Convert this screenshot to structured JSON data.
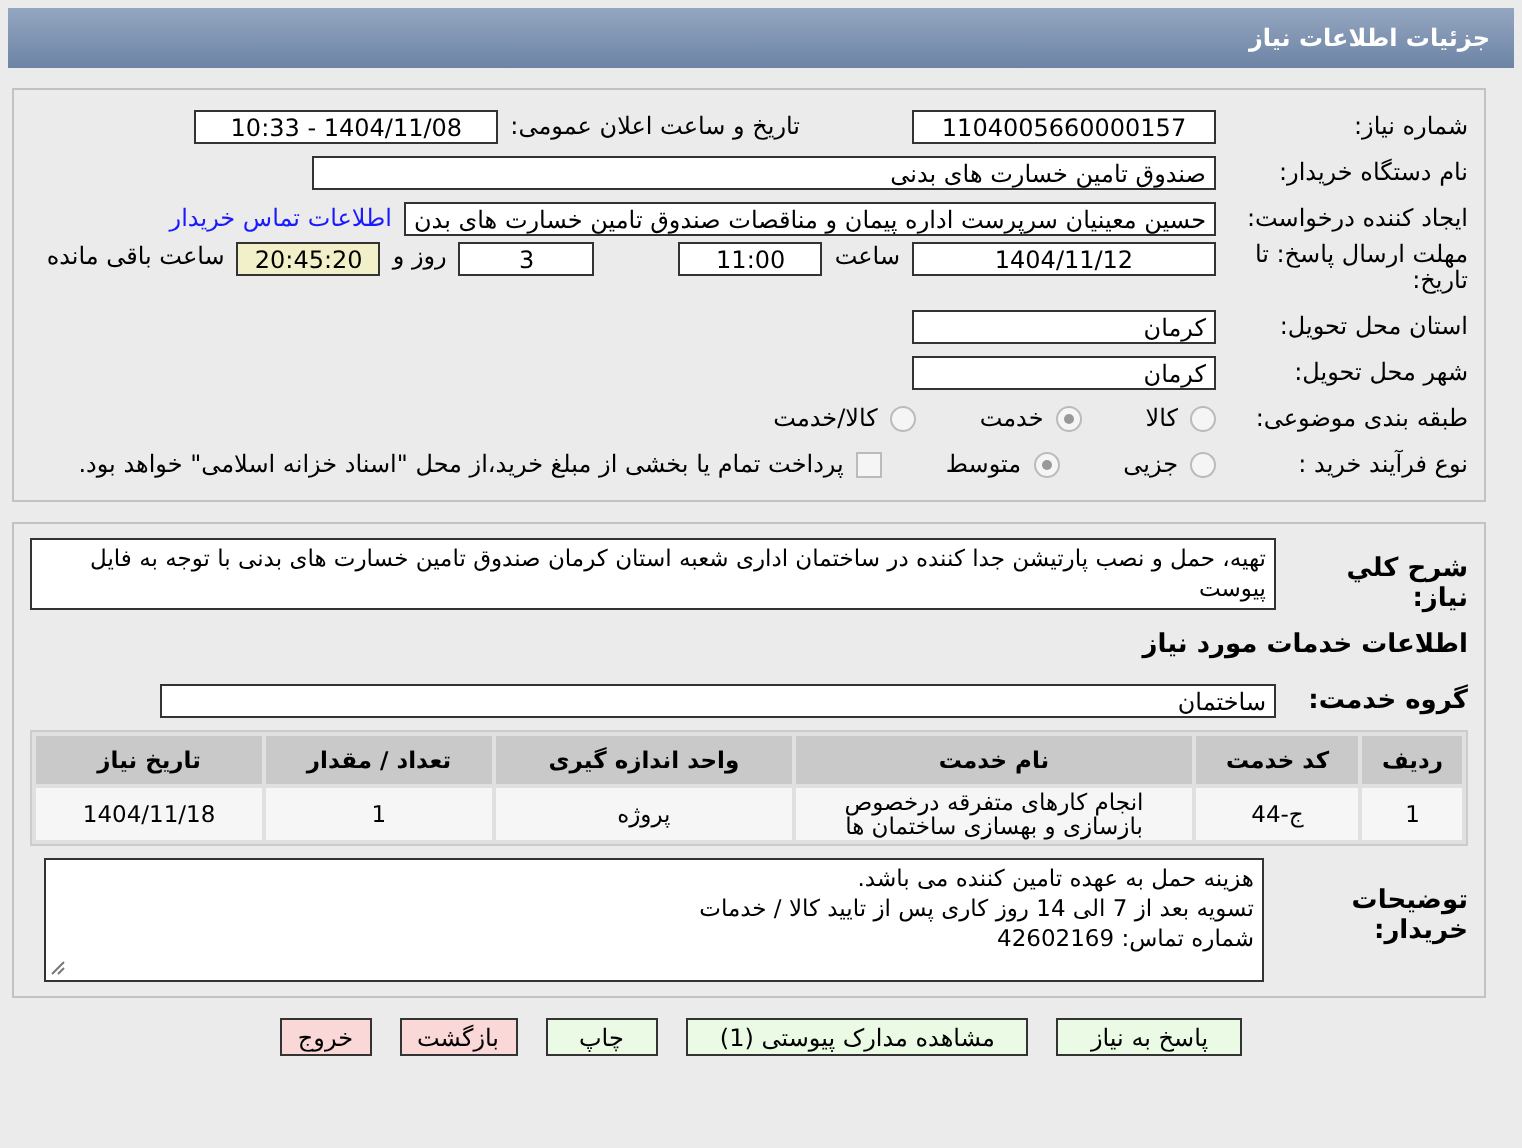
{
  "header": {
    "title": "جزئیات اطلاعات نیاز"
  },
  "need_number": {
    "label": "شماره نیاز:",
    "value": "1104005660000157"
  },
  "announce": {
    "label": "تاریخ و ساعت اعلان عمومی:",
    "value": "1404/11/08 - 10:33"
  },
  "buyer": {
    "label": "نام دستگاه خریدار:",
    "value": "صندوق تامین خسارت های بدنی"
  },
  "creator": {
    "label": "ایجاد کننده درخواست:",
    "value": "حسین  معینیان سرپرست اداره پیمان و مناقصات صندوق تامین خسارت های بدن",
    "link": "اطلاعات تماس خریدار"
  },
  "deadline": {
    "label": "مهلت ارسال پاسخ: تا تاریخ:",
    "date": "1404/11/12",
    "time_label": "ساعت",
    "time": "11:00",
    "days": "3",
    "days_label": "روز و",
    "remaining": "20:45:20",
    "remaining_label": "ساعت باقی مانده"
  },
  "province": {
    "label": "استان محل تحویل:",
    "value": "کرمان"
  },
  "city": {
    "label": "شهر محل تحویل:",
    "value": "کرمان"
  },
  "category": {
    "label": "طبقه بندی موضوعی:",
    "options": [
      {
        "label": "کالا",
        "selected": false
      },
      {
        "label": "خدمت",
        "selected": true
      },
      {
        "label": "کالا/خدمت",
        "selected": false
      }
    ]
  },
  "process": {
    "label": "نوع فرآیند خرید :",
    "options": [
      {
        "label": "جزیی",
        "selected": false
      },
      {
        "label": "متوسط",
        "selected": true
      }
    ],
    "payment": {
      "checked": false,
      "text": "پرداخت تمام یا بخشی از مبلغ خرید،از محل \"اسناد خزانه اسلامی\" خواهد بود."
    }
  },
  "description": {
    "label": "شرح کلي نياز:",
    "value": "تهیه، حمل و نصب پارتیشن جدا کننده در ساختمان اداری شعبه استان کرمان صندوق تامین خسارت های بدنی با توجه به فایل پیوست"
  },
  "services_title": "اطلاعات خدمات مورد نياز",
  "service_group": {
    "label": "گروه خدمت:",
    "value": "ساختمان"
  },
  "table": {
    "columns": [
      "رديف",
      "كد خدمت",
      "نام خدمت",
      "واحد اندازه گیری",
      "تعداد / مقدار",
      "تاریخ نیاز"
    ],
    "rows": [
      [
        "1",
        "ج-44",
        "انجام کارهای متفرقه درخصوص بازسازی و بهسازی ساختمان ها",
        "پروژه",
        "1",
        "1404/11/18"
      ]
    ]
  },
  "notes": {
    "label": "توضیحات خریدار:",
    "lines": [
      "هزینه حمل به عهده تامین کننده می باشد.",
      "تسویه بعد از 7 الی 14 روز کاری پس از تایید کالا / خدمات",
      "شماره تماس: 42602169"
    ]
  },
  "buttons": [
    {
      "label": "پاسخ به نیاز",
      "kind": "action"
    },
    {
      "label": "مشاهده مدارک پیوستی (1)",
      "kind": "action"
    },
    {
      "label": "چاپ",
      "kind": "action"
    },
    {
      "label": "بازگشت",
      "kind": "exit"
    },
    {
      "label": "خروج",
      "kind": "exit"
    }
  ]
}
